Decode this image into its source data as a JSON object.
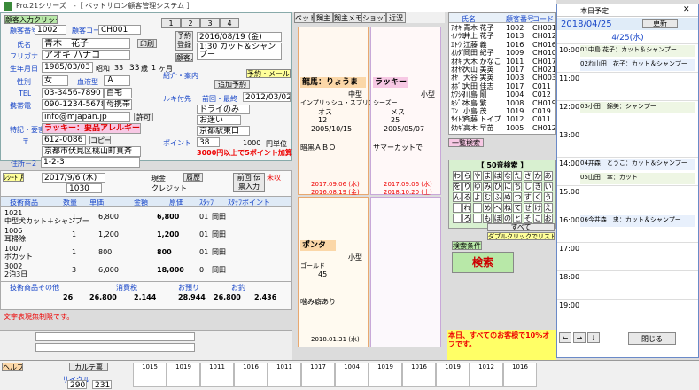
{
  "window": {
    "title": "Pro.21シリーズ　-［ ペットサロン顧客管理システム ］"
  },
  "customer": {
    "club_btn": "顧客入力クリック",
    "no_label": "顧客番号",
    "no": "1002",
    "code_label": "顧客コード",
    "code": "CH001",
    "name_label": "氏名",
    "name": "青木　花子",
    "print_btn": "印刷",
    "furigana_label": "フリガナ",
    "furigana": "アオキ ハナコ",
    "birth_label": "生年月日",
    "birth": "1985/03/03",
    "era": "昭和",
    "era_year": "33",
    "age": "33",
    "age_unit": "歳",
    "months": "1",
    "months_unit": "ヶ月",
    "gender_label": "性別",
    "gender": "女",
    "blood_label": "血液型",
    "blood": "Ａ",
    "tel_label": "TEL",
    "tel": "03-3456-7890",
    "tel_type": "自宅",
    "mobile_label": "携帯電",
    "mobile": "090-1234-5678",
    "mobile_type": "母携帯",
    "mail": "info@mjapan.jp",
    "permit": "許可",
    "feature_label": "特記・要害",
    "feature": "ラッキー：要品アレルギー！",
    "zip_label": "〒",
    "zip": "612-0086",
    "copy_btn": "コピー",
    "addr_label": "住所－1",
    "addr1": "京都市伏見区桃山町真斉",
    "addr2_label": "住所－2",
    "addr2": "1-2-3"
  },
  "visit": {
    "tabs": [
      "1",
      "2",
      "3",
      "4"
    ],
    "kakusho": "予約登録",
    "date": "2016/08/19 (金)",
    "memo": "1:30 カット＆シャンプー",
    "hist_btn": "顧客入力",
    "last_label": "前回・最終",
    "last_date": "2012/03/02",
    "rainten_label": "来店日数",
    "fix_label": "ルキ付先",
    "fixdrive": "ドライのみ",
    "otsuke": "お迷い",
    "resv": "予約",
    "intro_label": "紹介・案内",
    "resv_mail_btn": "予約・メール送信",
    "addr_btn": "追加予約",
    "hotel_label": "ペット情報",
    "hotel": "京都駅東口",
    "point_label": "ポイント",
    "point": "38",
    "point_val": "1000",
    "point_unit": "円単位",
    "notice": "3000円以上で5ポイント加算"
  },
  "sales": {
    "label": "ﾚｼｰﾄ 月",
    "date": "2017/9/6 (水)",
    "time": "1030",
    "cash": "現金",
    "credit": "クレジット",
    "uncon": "未収",
    "history_btn": "履歴",
    "return_btn": "前回 伝票入力",
    "cols": [
      "技術商品",
      "数量",
      "単価",
      "金額",
      "原価",
      "ｽﾀｯﾌ",
      "ｽﾀｯﾌポイント"
    ],
    "rows": [
      {
        "code": "1021",
        "name": "中型犬カット＋シャンプー",
        "qty": "1",
        "unit": "6,800",
        "amt": "6,800",
        "s": "01",
        "memo": "岡田"
      },
      {
        "code": "1006",
        "name": "耳掃除",
        "qty": "1",
        "unit": "1,200",
        "amt": "1,200",
        "s": "01",
        "memo": "岡田"
      },
      {
        "code": "1007",
        "name": "ボカット",
        "qty": "1",
        "unit": "800",
        "amt": "800",
        "s": "01",
        "memo": "岡田"
      },
      {
        "code": "3002",
        "name": "2泊3日",
        "qty": "3",
        "unit": "6,000",
        "amt": "18,000",
        "s": "0",
        "memo": "岡田"
      }
    ],
    "totals": {
      "l1": "技術商品その他",
      "l2": "消費税",
      "l3": "お預り",
      "l4": "お釣",
      "t1": "26",
      "t2": "26,800",
      "t3": "2,144",
      "t4": "28,944",
      "t5": "26,800",
      "t6": "2,436",
      "t7": "26,800"
    },
    "note": "文字表現無制限です。"
  },
  "pets": {
    "tabs": [
      "ペット",
      "飼主",
      "飼主メモ",
      "ショップ",
      "近況"
    ],
    "p1": {
      "name": "龍馬：りょうま",
      "size": "中型",
      "breed": "インプリッシュ・スプリンガー",
      "sex": "オス",
      "weight": "12",
      "born": "2005/10/15",
      "memo": "暗黒ＡＢＯ",
      "last": "2017.09.06 (水)",
      "next": "2016.08.19 (金)"
    },
    "p2": {
      "name": "ラッキー",
      "size": "小型",
      "breed": "シーズー",
      "sex": "メス",
      "weight": "25",
      "born": "2005/05/07",
      "memo": "サマーカットで",
      "last": "2017.09.06 (水)",
      "next": "2018.10.20 (土)"
    },
    "p3": {
      "name": "ポンタ",
      "size": "小型",
      "breed": "ゴールド",
      "weight": "45",
      "memo": "噛み癖あり",
      "next": "2018.01.31 (水)"
    }
  },
  "list": {
    "head": [
      "氏名",
      "顧客番号",
      "コード"
    ],
    "rows": [
      [
        "ｱｵｷ",
        "青木 花子",
        "1002",
        "CH001"
      ],
      [
        "ｲﾉｳｴ",
        "井上 花子",
        "1013",
        "CH012"
      ],
      [
        "ｴﾄｳ",
        "江藤 義",
        "1016",
        "CH016"
      ],
      [
        "ｵｶﾀﾞ",
        "岡田 紀子",
        "1009",
        "CH010"
      ],
      [
        "ｵｵｷ",
        "大木 かなこ",
        "1011",
        "CH017"
      ],
      [
        "ｵｵﾔﾏ",
        "大山 美英",
        "1017",
        "CH021"
      ],
      [
        "ｵﾔ",
        "大谷 実英",
        "1003",
        "CH003"
      ],
      [
        "ｵﾎﾞﾛ",
        "大田 佳志",
        "1017",
        "C011"
      ],
      [
        "ｶﾜｼﾏ",
        "川島 剛",
        "1004",
        "C012"
      ],
      [
        "ｷｼﾞﾏ",
        "木島 繁",
        "1008",
        "CH019"
      ],
      [
        "ｺﾝ",
        "小島 茂",
        "1019",
        "C019"
      ],
      [
        "ｻｲﾄｳ",
        "斉藤 トイプ",
        "1012",
        "C011"
      ],
      [
        "ﾀｶｷﾞ",
        "高木 早苗",
        "1005",
        "CH012"
      ]
    ],
    "kana_title": "【 50音検索 】",
    "kana": [
      "わ",
      "ら",
      "や",
      "ま",
      "は",
      "な",
      "た",
      "さ",
      "か",
      "あ",
      "を",
      "り",
      "ゆ",
      "み",
      "ひ",
      "に",
      "ち",
      "し",
      "き",
      "い",
      "ん",
      "る",
      "よ",
      "む",
      "ふ",
      "ぬ",
      "つ",
      "す",
      "く",
      "う",
      "",
      "れ",
      "",
      "め",
      "へ",
      "ね",
      "て",
      "せ",
      "け",
      "え",
      "",
      "ろ",
      "",
      "も",
      "ほ",
      "の",
      "と",
      "そ",
      "こ",
      "お"
    ],
    "search": "検索",
    "all_btn": "すべて",
    "cond": "ダブルクリックでリストを表示",
    "search_cond": "検索条件",
    "banner": "本日、すべてのお客様で10%オフです。",
    "one_btn": "一覧検索"
  },
  "sched": {
    "title": "本日予定",
    "date": "2018/04/25",
    "update": "更新",
    "day": "4/25(水)",
    "entries": [
      {
        "t": "10:00",
        "txt": "01中島 花子：カット＆シャンプー"
      },
      {
        "t": "",
        "txt": "02れ山田　花子：カット＆シャンプー"
      },
      {
        "t": "12:00",
        "txt": "03小田　錦美：シャンプー"
      },
      {
        "t": "14:00",
        "txt": "04井森　とうこ：カット＆シャンプー"
      },
      {
        "t": "",
        "txt": "05山田　幸：カット"
      },
      {
        "t": "16:00",
        "txt": "06今井森　忠：カット＆シャンプー"
      }
    ],
    "times": [
      "10:00",
      "11:00",
      "12:00",
      "13:00",
      "14:00",
      "15:00",
      "16:00",
      "17:00",
      "18:00",
      "19:00"
    ],
    "close": "閉じる"
  },
  "footer": {
    "help": "ヘルプ",
    "card": "カルテ票",
    "age": "290",
    "cnt": "231",
    "cycle": "サイクル",
    "last": "前回平均",
    "nums": [
      "1015",
      "1019",
      "1011",
      "1016",
      "1011",
      "1017",
      "1004",
      "1019",
      "1016",
      "1019",
      "1012",
      "1016"
    ]
  }
}
